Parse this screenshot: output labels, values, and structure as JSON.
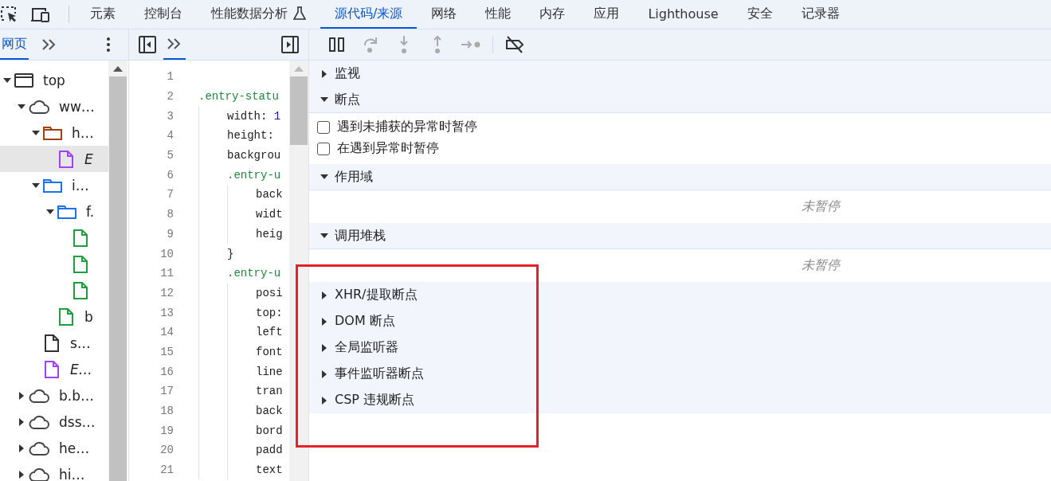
{
  "main_tabs": [
    {
      "label": "元素",
      "kind": "plain",
      "selected": false
    },
    {
      "label": "控制台",
      "kind": "plain",
      "selected": false
    },
    {
      "label": "性能数据分析",
      "kind": "experiment",
      "selected": false
    },
    {
      "label": "源代码/来源",
      "kind": "plain",
      "selected": true
    },
    {
      "label": "网络",
      "kind": "plain",
      "selected": false
    },
    {
      "label": "性能",
      "kind": "plain",
      "selected": false
    },
    {
      "label": "内存",
      "kind": "plain",
      "selected": false
    },
    {
      "label": "应用",
      "kind": "plain",
      "selected": false
    },
    {
      "label": "Lighthouse",
      "kind": "plain",
      "selected": false
    },
    {
      "label": "安全",
      "kind": "plain",
      "selected": false
    },
    {
      "label": "记录器",
      "kind": "plain",
      "selected": false
    }
  ],
  "navigator": {
    "tabs": [
      {
        "label": "网页",
        "selected": true
      }
    ],
    "tree": [
      {
        "label": "top",
        "kind": "frame",
        "expanded": true,
        "selected": false,
        "children": [
          {
            "label": "ww…",
            "kind": "origin",
            "expanded": true,
            "selected": false,
            "children": [
              {
                "label": "h…",
                "kind": "folder",
                "color": "#a0410d",
                "expanded": true,
                "selected": false,
                "children": [
                  {
                    "label": "E",
                    "kind": "file",
                    "color": "#a142f4",
                    "italic": true,
                    "selected": true
                  }
                ]
              },
              {
                "label": "i…",
                "kind": "folder",
                "color": "#1a73e8",
                "expanded": true,
                "selected": false,
                "children": [
                  {
                    "label": "f.",
                    "kind": "folder",
                    "color": "#1a73e8",
                    "expanded": true,
                    "selected": false,
                    "children": [
                      {
                        "kind": "file",
                        "color": "#1e9e3e",
                        "selected": false
                      },
                      {
                        "kind": "file",
                        "color": "#1e9e3e",
                        "selected": false
                      },
                      {
                        "kind": "file",
                        "color": "#1e9e3e",
                        "selected": false
                      }
                    ]
                  },
                  {
                    "label": "b",
                    "kind": "file",
                    "color": "#1e9e3e",
                    "italic": false,
                    "selected": false
                  }
                ]
              },
              {
                "label": "s…",
                "kind": "file",
                "color": "#333333",
                "italic": false,
                "selected": false
              },
              {
                "label": "E…",
                "kind": "file",
                "color": "#a142f4",
                "italic": true,
                "selected": false
              }
            ]
          },
          {
            "label": "b.b…",
            "kind": "origin",
            "expanded": false,
            "selected": false
          },
          {
            "label": "dss…",
            "kind": "origin",
            "expanded": false,
            "selected": false
          },
          {
            "label": "he…",
            "kind": "origin",
            "expanded": false,
            "selected": false
          },
          {
            "label": "hi…",
            "kind": "origin",
            "expanded": false,
            "selected": false
          }
        ]
      }
    ]
  },
  "code": [
    {
      "number": "1"
    },
    {
      "number": "2",
      "kind": "selector",
      "text": ".entry-statu",
      "children": [
        {
          "number": "3",
          "kind": "property",
          "text": "width:",
          "value": "1"
        },
        {
          "number": "4",
          "kind": "property",
          "text": "height:"
        },
        {
          "number": "5",
          "kind": "property",
          "text": "backgrou"
        },
        {
          "number": "6",
          "kind": "selector",
          "text": ".entry-u",
          "children": [
            {
              "number": "7",
              "kind": "property",
              "text": "back"
            },
            {
              "number": "8",
              "kind": "property",
              "text": "widt"
            },
            {
              "number": "9",
              "kind": "property",
              "text": "heig"
            }
          ]
        },
        {
          "number": "10",
          "kind": "brace",
          "text": "}"
        },
        {
          "number": "11",
          "kind": "selector",
          "text": ".entry-u",
          "children": [
            {
              "number": "12",
              "kind": "property",
              "text": "posi"
            },
            {
              "number": "13",
              "kind": "property",
              "text": "top:"
            },
            {
              "number": "14",
              "kind": "property",
              "text": "left"
            },
            {
              "number": "15",
              "kind": "property",
              "text": "font"
            },
            {
              "number": "16",
              "kind": "property",
              "text": "line"
            },
            {
              "number": "17",
              "kind": "property",
              "text": "tran"
            },
            {
              "number": "18",
              "kind": "property",
              "text": "back"
            },
            {
              "number": "19",
              "kind": "property",
              "text": "bord"
            },
            {
              "number": "20",
              "kind": "property",
              "text": "padd"
            },
            {
              "number": "21",
              "kind": "property",
              "text": "text"
            }
          ]
        }
      ]
    }
  ],
  "debugger": {
    "toolbar": [
      {
        "kind": "pause",
        "disabled": false
      },
      {
        "kind": "step-over",
        "disabled": true
      },
      {
        "kind": "step-into",
        "disabled": true
      },
      {
        "kind": "step-out",
        "disabled": true
      },
      {
        "kind": "step",
        "disabled": true
      },
      {
        "kind": "deactivate",
        "disabled": false
      }
    ],
    "sections": [
      {
        "title": "监视",
        "expanded": false
      },
      {
        "title": "断点",
        "expanded": true,
        "checkboxes": [
          {
            "label": "遇到未捕获的异常时暂停",
            "checked": false
          },
          {
            "label": "在遇到异常时暂停",
            "checked": false
          }
        ]
      },
      {
        "title": "作用域",
        "expanded": true,
        "message": "未暂停"
      },
      {
        "title": "调用堆栈",
        "expanded": true,
        "message": "未暂停"
      },
      {
        "title": "XHR/提取断点",
        "expanded": false
      },
      {
        "title": "DOM 断点",
        "expanded": false
      },
      {
        "title": "全局监听器",
        "expanded": false
      },
      {
        "title": "事件监听器断点",
        "expanded": false
      },
      {
        "title": "CSP 违规断点",
        "expanded": false
      }
    ]
  },
  "annotations": [
    {
      "kind": "rectangle"
    }
  ]
}
